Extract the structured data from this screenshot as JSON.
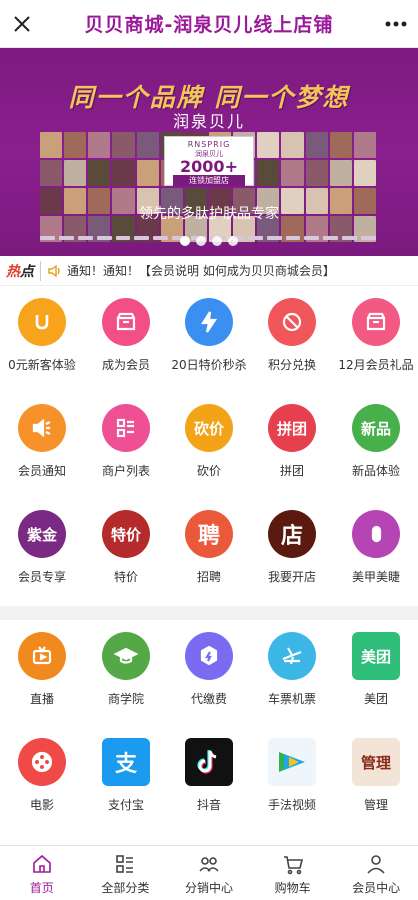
{
  "header": {
    "title": "贝贝商城-润泉贝儿线上店铺"
  },
  "banner": {
    "slogan": "同一个品牌 同一个梦想",
    "brand": "润泉贝儿",
    "card_brand_en": "RNSPRIG",
    "card_brand_cn": "润泉贝儿",
    "card_count": "2000+",
    "card_caption": "连锁加盟店",
    "tagline": "领先的多肽护肤品专家"
  },
  "notice": {
    "hot_label_a": "热",
    "hot_label_b": "点",
    "text": "通知！通知！【会员说明 如何成为贝贝商城会员】"
  },
  "grid1": [
    {
      "label": "0元新客体验",
      "icon": "u-shield-icon",
      "color": "#f7a41c"
    },
    {
      "label": "成为会员",
      "icon": "shop-icon",
      "color": "#f24f86"
    },
    {
      "label": "20日特价秒杀",
      "icon": "lightning-icon",
      "color": "#3a8ff0"
    },
    {
      "label": "积分兑换",
      "icon": "no-coupon-icon",
      "color": "#f1575a"
    },
    {
      "label": "12月会员礼品",
      "icon": "gift-shop-icon",
      "color": "#f25a83"
    },
    {
      "label": "会员通知",
      "icon": "speaker-icon",
      "color": "#f7922a"
    },
    {
      "label": "商户列表",
      "icon": "list-icon",
      "color": "#ef4f93"
    },
    {
      "label": "砍价",
      "icon": "bargain-icon",
      "color": "#f2a318",
      "text": "砍价"
    },
    {
      "label": "拼团",
      "icon": "group-buy-icon",
      "color": "#e6404f",
      "text": "拼团"
    },
    {
      "label": "新品体验",
      "icon": "new-product-icon",
      "color": "#47b04b",
      "text": "新品"
    },
    {
      "label": "会员专享",
      "icon": "member-badge-icon",
      "color": "#7b2a84",
      "text": "紫金"
    },
    {
      "label": "特价",
      "icon": "special-price-icon",
      "color": "#b52a2a",
      "text": "特价"
    },
    {
      "label": "招聘",
      "icon": "recruit-icon",
      "color": "#ea5a3a",
      "text": "聘"
    },
    {
      "label": "我要开店",
      "icon": "open-store-icon",
      "color": "#5a1a10",
      "text": "店"
    },
    {
      "label": "美甲美睫",
      "icon": "nail-icon",
      "color": "#b544b5"
    }
  ],
  "grid2": [
    {
      "label": "直播",
      "icon": "tv-icon",
      "color": "#f08a1e"
    },
    {
      "label": "商学院",
      "icon": "graduation-cap-icon",
      "color": "#54a946"
    },
    {
      "label": "代缴费",
      "icon": "payment-icon",
      "color": "#7b6bf0"
    },
    {
      "label": "车票机票",
      "icon": "plane-icon",
      "color": "#3bb6e6"
    },
    {
      "label": "美团",
      "icon": "meituan-icon",
      "color": "#2fbf7a",
      "text": "美团"
    },
    {
      "label": "电影",
      "icon": "film-icon",
      "color": "#ef4a48"
    },
    {
      "label": "支付宝",
      "icon": "alipay-icon",
      "color": "#1a9bef",
      "text": "支"
    },
    {
      "label": "抖音",
      "icon": "douyin-icon",
      "color": "#111111"
    },
    {
      "label": "手法视频",
      "icon": "video-icon",
      "color": "#1fb8e8"
    },
    {
      "label": "管理",
      "icon": "manage-icon",
      "color": "#c43a2a",
      "text": "管理"
    }
  ],
  "tabbar": [
    {
      "label": "首页",
      "icon": "home-icon"
    },
    {
      "label": "全部分类",
      "icon": "category-icon"
    },
    {
      "label": "分销中心",
      "icon": "people-icon"
    },
    {
      "label": "购物车",
      "icon": "cart-icon"
    },
    {
      "label": "会员中心",
      "icon": "user-icon"
    }
  ],
  "colors": {
    "accent": "#9b1a9b",
    "banner": "#7e1a80"
  }
}
